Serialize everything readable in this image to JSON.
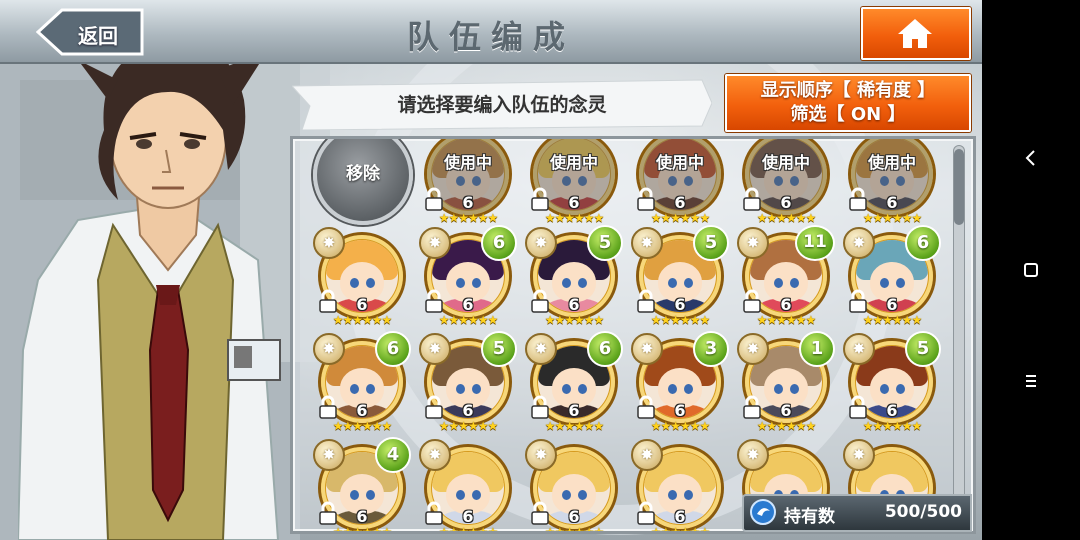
{
  "header": {
    "title": "队伍编成",
    "back_label": "返回",
    "home_icon": "home-icon"
  },
  "instruction": "请选择要编入队伍的念灵",
  "sort": {
    "line1": "显示顺序【 稀有度 】",
    "line2": "筛选【 ON 】"
  },
  "grid": {
    "remove_label": "移除",
    "in_use_label": "使用中",
    "row1": [
      {
        "in_use": true,
        "rank": "6",
        "stars": "★★★★★★",
        "hair": "#c2853c",
        "body": "#b04a2a"
      },
      {
        "in_use": true,
        "rank": "6",
        "stars": "★★★★★★",
        "hair": "#f0c84a",
        "body": "#c02a2a"
      },
      {
        "in_use": true,
        "rank": "6",
        "stars": "★★★★★★",
        "hair": "#c0441a",
        "body": "#5a2a1a"
      },
      {
        "in_use": true,
        "rank": "6",
        "stars": "★★★★★★",
        "hair": "#6a4a3a",
        "body": "#4a3a3a"
      },
      {
        "in_use": true,
        "rank": "6",
        "stars": "★★★★★★",
        "hair": "#d08a2a",
        "body": "#3a3a4a"
      }
    ],
    "row2": [
      {
        "level": "",
        "rank": "6",
        "stars": "★★★★★★",
        "hair": "#f4b04a",
        "body": "#d94a4a"
      },
      {
        "level": "6",
        "rank": "6",
        "stars": "★★★★★★",
        "hair": "#3a1a4a",
        "body": "#e06a8a"
      },
      {
        "level": "5",
        "rank": "6",
        "stars": "★★★★★★",
        "hair": "#2a1a3a",
        "body": "#e88aa0"
      },
      {
        "level": "5",
        "rank": "6",
        "stars": "★★★★★★",
        "hair": "#e0a040",
        "body": "#2a3a6a"
      },
      {
        "level": "11",
        "rank": "6",
        "stars": "★★★★★★",
        "hair": "#b07040",
        "body": "#e04a5a"
      },
      {
        "level": "6",
        "rank": "6",
        "stars": "★★★★★★",
        "hair": "#6aa6b8",
        "body": "#d04050"
      }
    ],
    "row3": [
      {
        "level": "6",
        "rank": "6",
        "stars": "★★★★★★",
        "hair": "#d08a3a",
        "body": "#8a5a3a"
      },
      {
        "level": "5",
        "rank": "6",
        "stars": "★★★★★★",
        "hair": "#7a5a3a",
        "body": "#3a3a5a"
      },
      {
        "level": "6",
        "rank": "6",
        "stars": "★★★★★★",
        "hair": "#2a2a2a",
        "body": "#3a2a2a"
      },
      {
        "level": "3",
        "rank": "6",
        "stars": "★★★★★★",
        "hair": "#a04a1a",
        "body": "#e06a2a"
      },
      {
        "level": "1",
        "rank": "6",
        "stars": "★★★★★★",
        "hair": "#a88a6a",
        "body": "#4a4a5a"
      },
      {
        "level": "5",
        "rank": "6",
        "stars": "★★★★★★",
        "hair": "#8a3a1a",
        "body": "#3a4a8a"
      }
    ],
    "row4": [
      {
        "level": "4",
        "rank": "6",
        "stars": "★★★★★★",
        "hair": "#d8b86a",
        "body": "#6a5a3a"
      },
      {
        "level": "",
        "rank": "6",
        "stars": "★★★★★★",
        "hair": "#f0c860",
        "body": "#d0d8e8"
      },
      {
        "level": "",
        "rank": "6",
        "stars": "★★★★★★",
        "hair": "#f0c860",
        "body": "#d0d8e8"
      },
      {
        "level": "",
        "rank": "6",
        "stars": "★★★★★★",
        "hair": "#f0c860",
        "body": "#d0d8e8"
      },
      {
        "level": "",
        "rank": "6",
        "stars": "★★★★★★",
        "hair": "#f0c860",
        "body": "#d0d8e8"
      },
      {
        "level": "",
        "rank": "6",
        "stars": "★★★★★★",
        "hair": "#f0c860",
        "body": "#d0d8e8"
      }
    ]
  },
  "holdings": {
    "label": "持有数",
    "value": "500/500"
  },
  "system_nav": {
    "back_icon": "back-arrow-icon",
    "home_icon": "square-home-icon",
    "menu_icon": "menu-lines-icon"
  },
  "colors": {
    "accent_orange": "#f2600d",
    "level_green": "#5aa21a",
    "frame_gold": "#d59a1e"
  }
}
